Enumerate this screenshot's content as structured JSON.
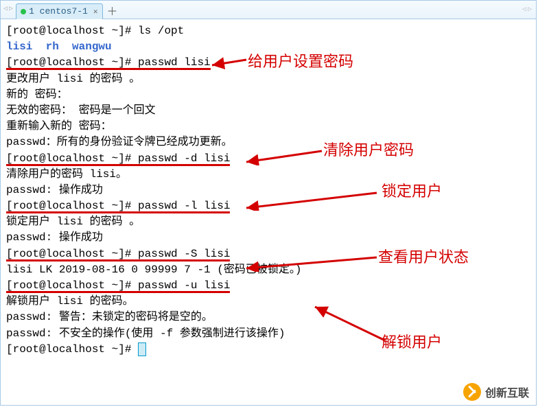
{
  "tabbar": {
    "tab_label": "1 centos7-1"
  },
  "terminal": {
    "prompt": "[root@localhost ~]# ",
    "cmd_ls": "ls /opt",
    "ls_output": {
      "p1": "lisi",
      "p2": "rh",
      "p3": "wangwu"
    },
    "cmd_passwd_set": "passwd lisi",
    "out_set_1": "更改用户 lisi 的密码 。",
    "out_set_2": "新的 密码：",
    "out_set_3": "无效的密码： 密码是一个回文",
    "out_set_4": "重新输入新的 密码：",
    "out_set_5": "passwd：所有的身份验证令牌已经成功更新。",
    "cmd_passwd_d": "passwd -d lisi",
    "out_d_1": "清除用户的密码 lisi。",
    "out_d_2": "passwd: 操作成功",
    "cmd_passwd_l": "passwd -l lisi",
    "out_l_1": "锁定用户 lisi 的密码 。",
    "out_l_2": "passwd: 操作成功",
    "cmd_passwd_S": "passwd -S lisi",
    "out_S": "lisi LK 2019-08-16 0 99999 7 -1 (密码已被锁定。)",
    "cmd_passwd_u": "passwd -u lisi",
    "out_u_1": "解锁用户 lisi 的密码。",
    "out_u_2": "passwd: 警告：未锁定的密码将是空的。",
    "out_u_3": "passwd: 不安全的操作(使用 -f 参数强制进行该操作)"
  },
  "annotations": {
    "a1": "给用户设置密码",
    "a2": "清除用户密码",
    "a3": "锁定用户",
    "a4": "查看用户状态",
    "a5": "解锁用户"
  },
  "watermark": {
    "text": "创新互联"
  }
}
